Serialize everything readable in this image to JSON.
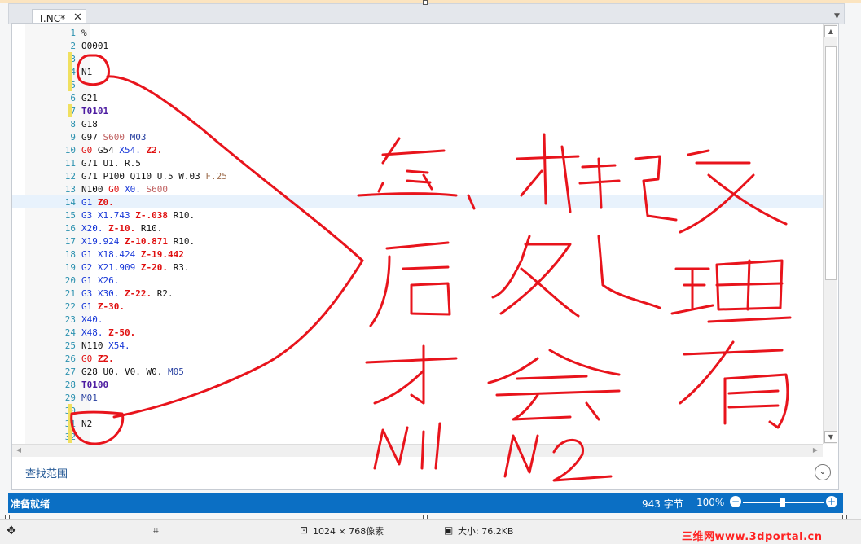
{
  "window": {
    "tab_title": "T.NC*",
    "tab_close": "✕",
    "tab_menu": "▼"
  },
  "editor": {
    "lines": [
      {
        "n": "1",
        "m": false,
        "tokens": [
          [
            "",
            "%"
          ]
        ]
      },
      {
        "n": "2",
        "m": false,
        "tokens": [
          [
            "",
            "O0001"
          ]
        ]
      },
      {
        "n": "3",
        "m": true,
        "tokens": []
      },
      {
        "n": "4",
        "m": true,
        "tokens": [
          [
            "",
            "N1"
          ]
        ]
      },
      {
        "n": "5",
        "m": true,
        "tokens": []
      },
      {
        "n": "6",
        "m": false,
        "tokens": [
          [
            "",
            "G21"
          ]
        ]
      },
      {
        "n": "7",
        "m": true,
        "tokens": [
          [
            "t",
            "T0101"
          ]
        ]
      },
      {
        "n": "8",
        "m": false,
        "tokens": [
          [
            "",
            "G18"
          ]
        ]
      },
      {
        "n": "9",
        "m": false,
        "tokens": [
          [
            "",
            "G97 "
          ],
          [
            "s",
            "S600"
          ],
          [
            "",
            " "
          ],
          [
            "m",
            "M03"
          ]
        ]
      },
      {
        "n": "10",
        "m": false,
        "tokens": [
          [
            "g",
            "G0"
          ],
          [
            "",
            " G54 "
          ],
          [
            "x",
            "X54."
          ],
          [
            "",
            " "
          ],
          [
            "z",
            "Z2."
          ]
        ]
      },
      {
        "n": "11",
        "m": false,
        "tokens": [
          [
            "",
            "G71 U1. R.5"
          ]
        ]
      },
      {
        "n": "12",
        "m": false,
        "tokens": [
          [
            "",
            "G71 P100 Q110 U.5 W.03 "
          ],
          [
            "f",
            "F.25"
          ]
        ]
      },
      {
        "n": "13",
        "m": false,
        "tokens": [
          [
            "",
            "N100 "
          ],
          [
            "g",
            "G0"
          ],
          [
            "",
            " "
          ],
          [
            "x",
            "X0."
          ],
          [
            "",
            " "
          ],
          [
            "s",
            "S600"
          ]
        ]
      },
      {
        "n": "14",
        "m": false,
        "hl": true,
        "tokens": [
          [
            "x",
            "G1"
          ],
          [
            "",
            " "
          ],
          [
            "z",
            "Z0."
          ]
        ]
      },
      {
        "n": "15",
        "m": false,
        "tokens": [
          [
            "x",
            "G3 X1.743"
          ],
          [
            "",
            " "
          ],
          [
            "z",
            "Z-.038"
          ],
          [
            "",
            " R10."
          ]
        ]
      },
      {
        "n": "16",
        "m": false,
        "tokens": [
          [
            "x",
            "X20."
          ],
          [
            "",
            " "
          ],
          [
            "z",
            "Z-10."
          ],
          [
            "",
            " R10."
          ]
        ]
      },
      {
        "n": "17",
        "m": false,
        "tokens": [
          [
            "x",
            "X19.924"
          ],
          [
            "",
            " "
          ],
          [
            "z",
            "Z-10.871"
          ],
          [
            "",
            " R10."
          ]
        ]
      },
      {
        "n": "18",
        "m": false,
        "tokens": [
          [
            "x",
            "G1 X18.424"
          ],
          [
            "",
            " "
          ],
          [
            "z",
            "Z-19.442"
          ]
        ]
      },
      {
        "n": "19",
        "m": false,
        "tokens": [
          [
            "x",
            "G2 X21.909"
          ],
          [
            "",
            " "
          ],
          [
            "z",
            "Z-20."
          ],
          [
            "",
            " R3."
          ]
        ]
      },
      {
        "n": "20",
        "m": false,
        "tokens": [
          [
            "x",
            "G1 X26."
          ]
        ]
      },
      {
        "n": "21",
        "m": false,
        "tokens": [
          [
            "x",
            "G3 X30."
          ],
          [
            "",
            " "
          ],
          [
            "z",
            "Z-22."
          ],
          [
            "",
            " R2."
          ]
        ]
      },
      {
        "n": "22",
        "m": false,
        "tokens": [
          [
            "x",
            "G1"
          ],
          [
            "",
            " "
          ],
          [
            "z",
            "Z-30."
          ]
        ]
      },
      {
        "n": "23",
        "m": false,
        "tokens": [
          [
            "x",
            "X40."
          ]
        ]
      },
      {
        "n": "24",
        "m": false,
        "tokens": [
          [
            "x",
            "X48."
          ],
          [
            "",
            " "
          ],
          [
            "z",
            "Z-50."
          ]
        ]
      },
      {
        "n": "25",
        "m": false,
        "tokens": [
          [
            "",
            "N110 "
          ],
          [
            "x",
            "X54."
          ]
        ]
      },
      {
        "n": "26",
        "m": false,
        "tokens": [
          [
            "g",
            "G0"
          ],
          [
            "",
            " "
          ],
          [
            "z",
            "Z2."
          ]
        ]
      },
      {
        "n": "27",
        "m": false,
        "tokens": [
          [
            "",
            "G28 U0. V0. W0. "
          ],
          [
            "m",
            "M05"
          ]
        ]
      },
      {
        "n": "28",
        "m": false,
        "tokens": [
          [
            "t",
            "T0100"
          ]
        ]
      },
      {
        "n": "29",
        "m": false,
        "tokens": [
          [
            "m",
            "M01"
          ]
        ]
      },
      {
        "n": "30",
        "m": true,
        "tokens": []
      },
      {
        "n": "31",
        "m": true,
        "tokens": [
          [
            "",
            "N2"
          ]
        ]
      },
      {
        "n": "32",
        "m": true,
        "tokens": []
      }
    ]
  },
  "find": {
    "label": "查找范围",
    "toggle": "⌄"
  },
  "status": {
    "ready": "准备就绪",
    "bytes": "943 字节",
    "zoom": "100%",
    "zoom_minus": "−",
    "zoom_plus": "+",
    "zoom_level": 0.45
  },
  "bottom": {
    "dimensions": "1024 × 768像素",
    "size": "大小: 76.2KB"
  },
  "watermark": "三维网www.3dportal.cn",
  "handwriting": "怎、样改后处理才会有N1 N2",
  "colors": {
    "status_bar": "#0b6fc4",
    "ink": "#e8141c",
    "marker": "#f0e060"
  }
}
